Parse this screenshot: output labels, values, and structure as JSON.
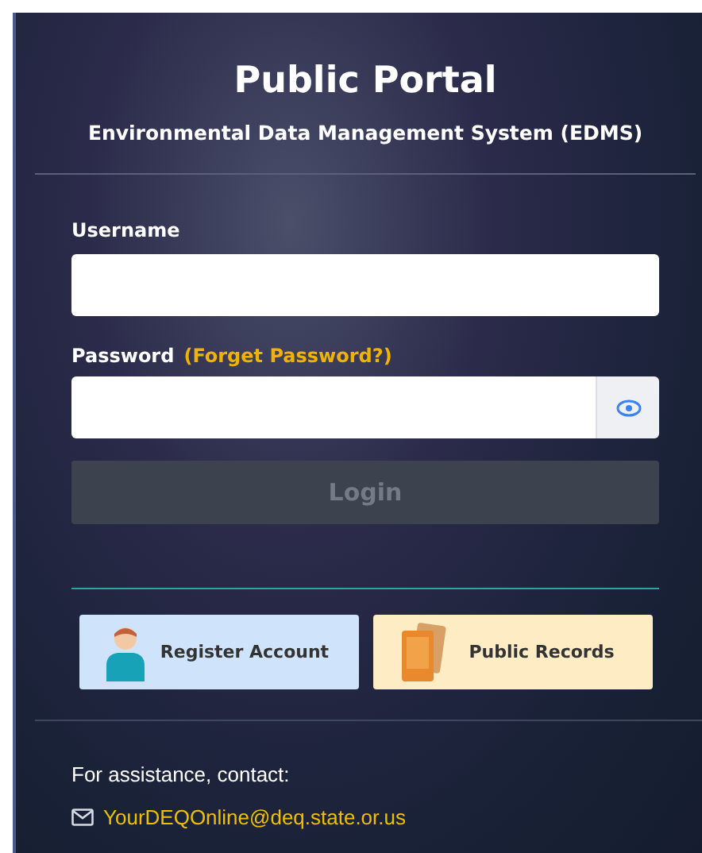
{
  "title": "Public Portal",
  "subtitle": "Environmental Data Management System (EDMS)",
  "username": {
    "label": "Username"
  },
  "password": {
    "label": "Password",
    "forgot_link": "(Forget Password?)"
  },
  "login_button": {
    "label": "Login",
    "disabled": true
  },
  "shortcuts": [
    {
      "kind": "register",
      "label": "Register Account"
    },
    {
      "kind": "records",
      "label": "Public Records"
    }
  ],
  "assistance": {
    "text": "For assistance, contact:",
    "email": "YourDEQOnline@deq.state.or.us"
  }
}
